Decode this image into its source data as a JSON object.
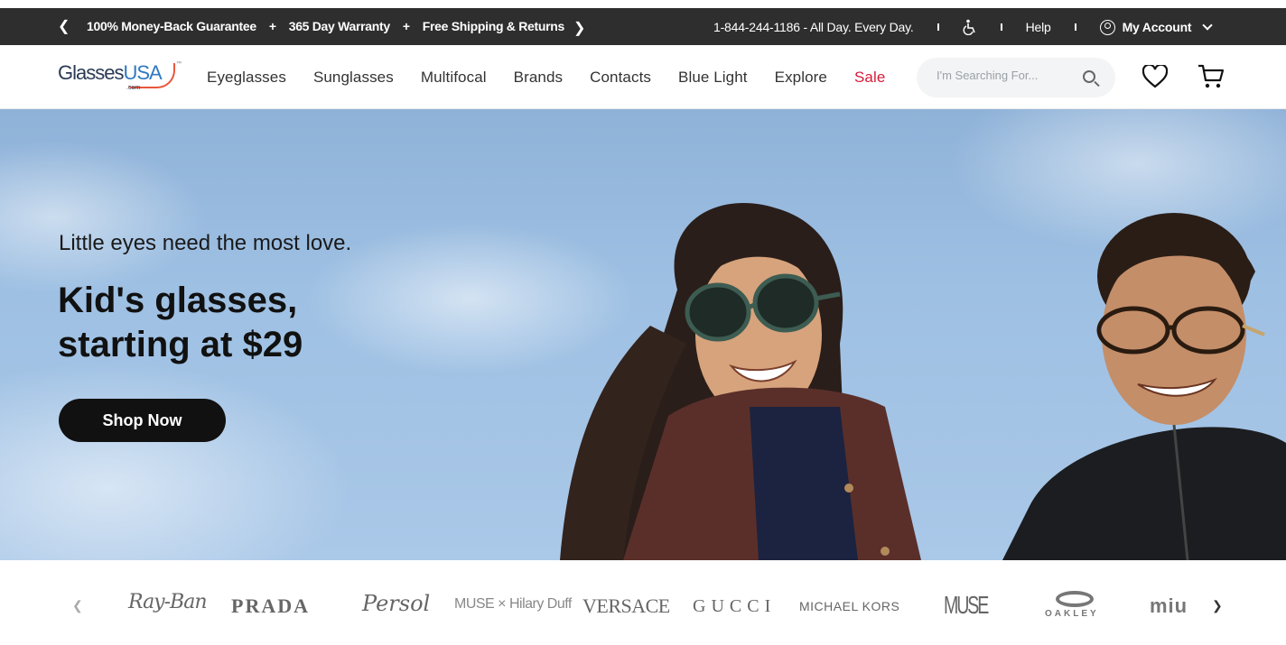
{
  "promo": {
    "messages": [
      "100% Money-Back Guarantee",
      "365 Day Warranty",
      "Free Shipping & Returns"
    ],
    "phone": "1-844-244-1186 - All Day. Every Day.",
    "help": "Help",
    "account": "My Account"
  },
  "header": {
    "logo_part1": "Glasses",
    "logo_part2": "USA",
    "logo_suffix": ".com",
    "logo_tm": "™",
    "nav": [
      "Eyeglasses",
      "Sunglasses",
      "Multifocal",
      "Brands",
      "Contacts",
      "Blue Light",
      "Explore",
      "Sale"
    ],
    "search_placeholder": "I'm Searching For..."
  },
  "hero": {
    "tagline": "Little eyes need the most love.",
    "title_line1": "Kid's glasses,",
    "title_line2": "starting at $29",
    "cta": "Shop Now"
  },
  "brands": {
    "items": [
      "Ray-Ban",
      "PRADA",
      "Persol",
      "MUSE × Hilary Duff",
      "VERSACE",
      "GUCCI",
      "MICHAEL KORS",
      "MUSE",
      "OAKLEY",
      "miu"
    ]
  },
  "colors": {
    "promo_bg": "#2e2e2e",
    "sale": "#d81b3c",
    "cta_bg": "#111111"
  }
}
